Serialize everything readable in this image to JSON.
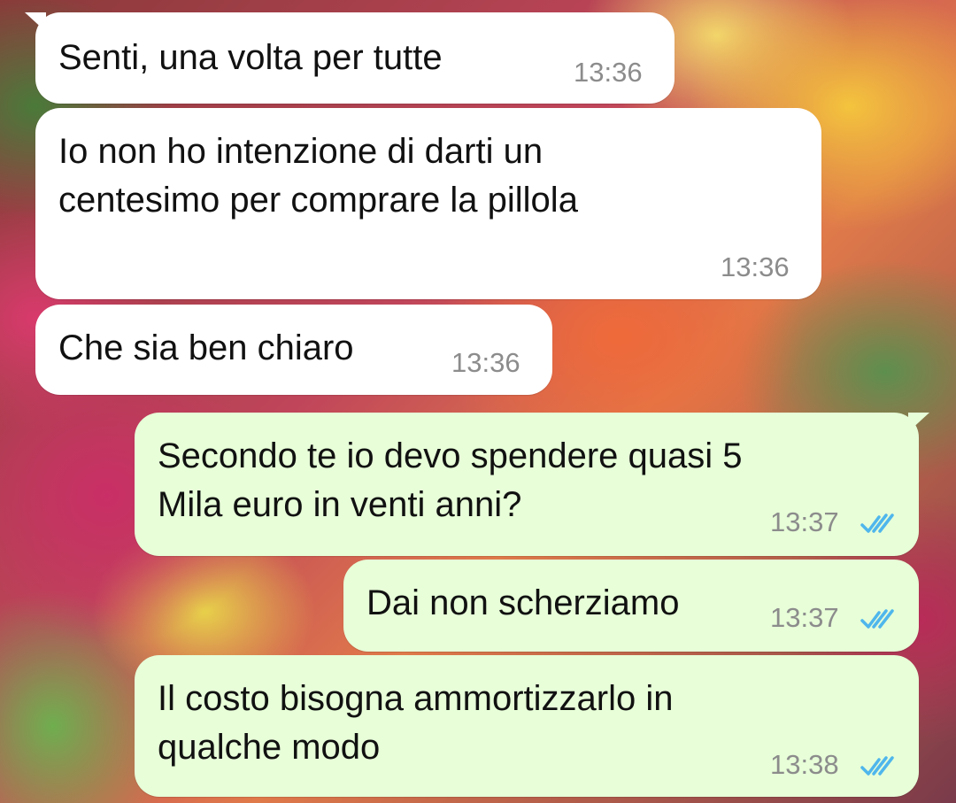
{
  "messages": [
    {
      "direction": "incoming",
      "text": "Senti, una volta per tutte",
      "time": "13:36"
    },
    {
      "direction": "incoming",
      "text": "Io non ho intenzione di darti un\ncentesimo per comprare la pillola",
      "time": "13:36"
    },
    {
      "direction": "incoming",
      "text": "Che sia ben chiaro",
      "time": "13:36"
    },
    {
      "direction": "outgoing",
      "text": "Secondo te io devo spendere quasi 5\nMila euro in venti anni?",
      "time": "13:37",
      "status_icon": "double-check-read-icon"
    },
    {
      "direction": "outgoing",
      "text": "Dai non scherziamo",
      "time": "13:37",
      "status_icon": "double-check-read-icon"
    },
    {
      "direction": "outgoing",
      "text": "Il costo bisogna ammortizzarlo in\nqualche modo",
      "time": "13:38",
      "status_icon": "double-check-read-icon"
    }
  ],
  "colors": {
    "incoming_bubble": "#ffffff",
    "outgoing_bubble": "#e7fed8",
    "timestamp": "#8c8c8c",
    "read_ticks": "#4fb6ec"
  }
}
